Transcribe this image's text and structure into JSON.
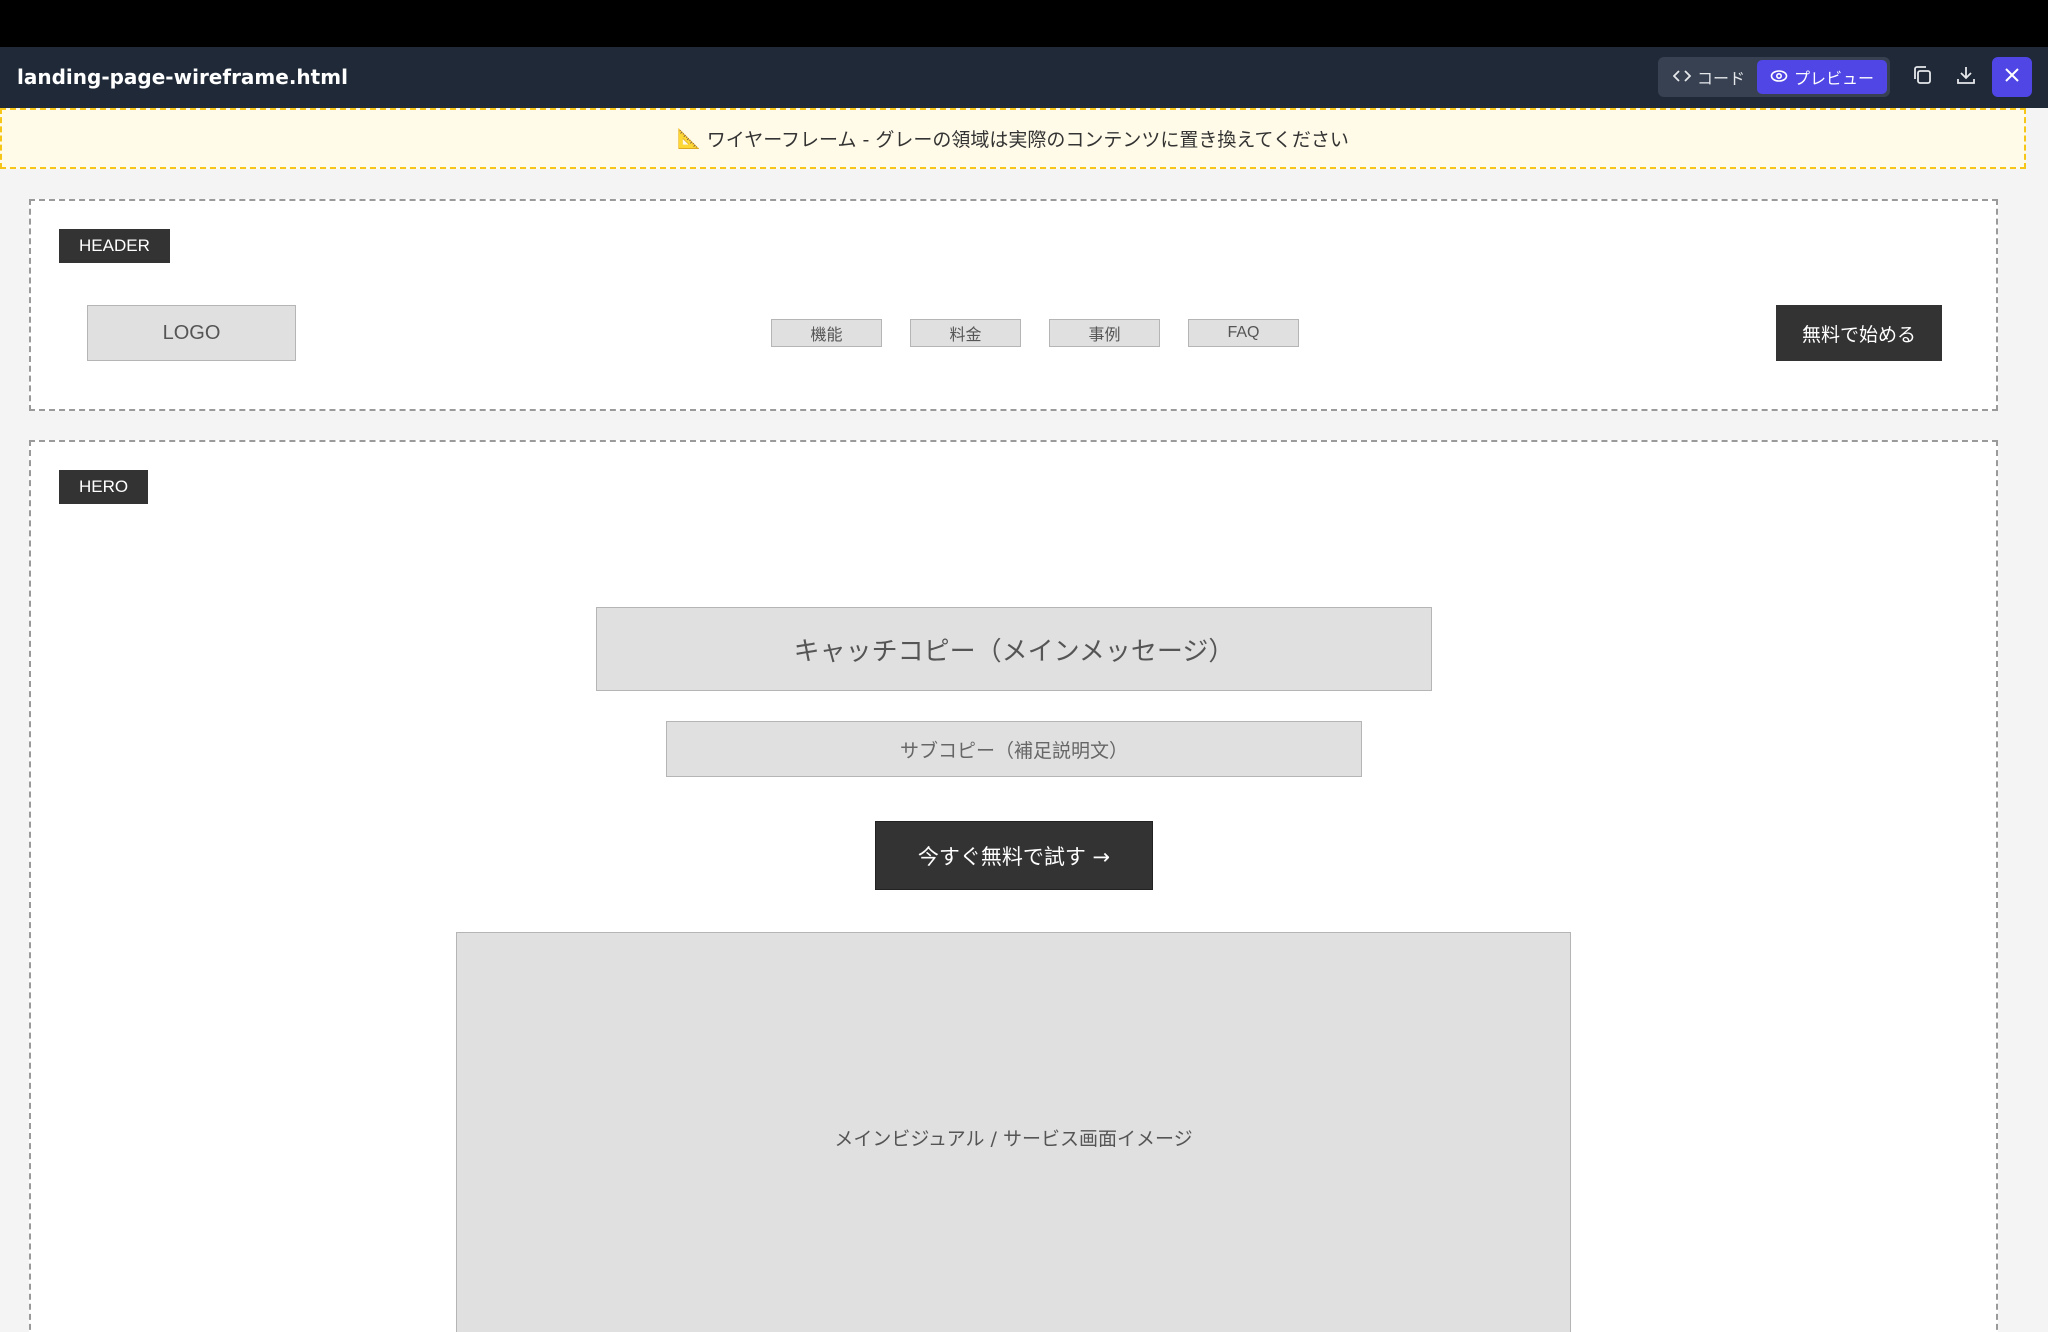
{
  "window": {
    "title": "landing-page-wireframe.html",
    "view_toggle": {
      "code_label": "コード",
      "preview_label": "プレビュー",
      "selected": "preview"
    },
    "icons": {
      "code": "code-icon",
      "preview": "eye-icon",
      "copy": "copy-icon",
      "download": "download-icon",
      "close": "close-icon"
    },
    "accent_color": "#4f46e5"
  },
  "notice": {
    "icon": "📐",
    "text": "ワイヤーフレーム - グレーの領域は実際のコンテンツに置き換えてください"
  },
  "header_section": {
    "tag": "HEADER",
    "logo": "LOGO",
    "nav": [
      "機能",
      "料金",
      "事例",
      "FAQ"
    ],
    "cta": "無料で始める"
  },
  "hero_section": {
    "tag": "HERO",
    "catch_copy": "キャッチコピー（メインメッセージ）",
    "sub_copy": "サブコピー（補足説明文）",
    "cta": "今すぐ無料で試す →",
    "visual": "メインビジュアル / サービス画面イメージ"
  }
}
